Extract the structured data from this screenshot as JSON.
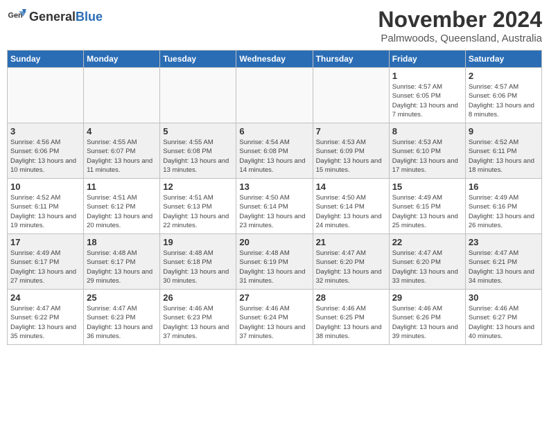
{
  "header": {
    "logo_general": "General",
    "logo_blue": "Blue",
    "month": "November 2024",
    "location": "Palmwoods, Queensland, Australia"
  },
  "weekdays": [
    "Sunday",
    "Monday",
    "Tuesday",
    "Wednesday",
    "Thursday",
    "Friday",
    "Saturday"
  ],
  "weeks": [
    [
      {
        "day": "",
        "info": ""
      },
      {
        "day": "",
        "info": ""
      },
      {
        "day": "",
        "info": ""
      },
      {
        "day": "",
        "info": ""
      },
      {
        "day": "",
        "info": ""
      },
      {
        "day": "1",
        "info": "Sunrise: 4:57 AM\nSunset: 6:05 PM\nDaylight: 13 hours and 7 minutes."
      },
      {
        "day": "2",
        "info": "Sunrise: 4:57 AM\nSunset: 6:06 PM\nDaylight: 13 hours and 8 minutes."
      }
    ],
    [
      {
        "day": "3",
        "info": "Sunrise: 4:56 AM\nSunset: 6:06 PM\nDaylight: 13 hours and 10 minutes."
      },
      {
        "day": "4",
        "info": "Sunrise: 4:55 AM\nSunset: 6:07 PM\nDaylight: 13 hours and 11 minutes."
      },
      {
        "day": "5",
        "info": "Sunrise: 4:55 AM\nSunset: 6:08 PM\nDaylight: 13 hours and 13 minutes."
      },
      {
        "day": "6",
        "info": "Sunrise: 4:54 AM\nSunset: 6:08 PM\nDaylight: 13 hours and 14 minutes."
      },
      {
        "day": "7",
        "info": "Sunrise: 4:53 AM\nSunset: 6:09 PM\nDaylight: 13 hours and 15 minutes."
      },
      {
        "day": "8",
        "info": "Sunrise: 4:53 AM\nSunset: 6:10 PM\nDaylight: 13 hours and 17 minutes."
      },
      {
        "day": "9",
        "info": "Sunrise: 4:52 AM\nSunset: 6:11 PM\nDaylight: 13 hours and 18 minutes."
      }
    ],
    [
      {
        "day": "10",
        "info": "Sunrise: 4:52 AM\nSunset: 6:11 PM\nDaylight: 13 hours and 19 minutes."
      },
      {
        "day": "11",
        "info": "Sunrise: 4:51 AM\nSunset: 6:12 PM\nDaylight: 13 hours and 20 minutes."
      },
      {
        "day": "12",
        "info": "Sunrise: 4:51 AM\nSunset: 6:13 PM\nDaylight: 13 hours and 22 minutes."
      },
      {
        "day": "13",
        "info": "Sunrise: 4:50 AM\nSunset: 6:14 PM\nDaylight: 13 hours and 23 minutes."
      },
      {
        "day": "14",
        "info": "Sunrise: 4:50 AM\nSunset: 6:14 PM\nDaylight: 13 hours and 24 minutes."
      },
      {
        "day": "15",
        "info": "Sunrise: 4:49 AM\nSunset: 6:15 PM\nDaylight: 13 hours and 25 minutes."
      },
      {
        "day": "16",
        "info": "Sunrise: 4:49 AM\nSunset: 6:16 PM\nDaylight: 13 hours and 26 minutes."
      }
    ],
    [
      {
        "day": "17",
        "info": "Sunrise: 4:49 AM\nSunset: 6:17 PM\nDaylight: 13 hours and 27 minutes."
      },
      {
        "day": "18",
        "info": "Sunrise: 4:48 AM\nSunset: 6:17 PM\nDaylight: 13 hours and 29 minutes."
      },
      {
        "day": "19",
        "info": "Sunrise: 4:48 AM\nSunset: 6:18 PM\nDaylight: 13 hours and 30 minutes."
      },
      {
        "day": "20",
        "info": "Sunrise: 4:48 AM\nSunset: 6:19 PM\nDaylight: 13 hours and 31 minutes."
      },
      {
        "day": "21",
        "info": "Sunrise: 4:47 AM\nSunset: 6:20 PM\nDaylight: 13 hours and 32 minutes."
      },
      {
        "day": "22",
        "info": "Sunrise: 4:47 AM\nSunset: 6:20 PM\nDaylight: 13 hours and 33 minutes."
      },
      {
        "day": "23",
        "info": "Sunrise: 4:47 AM\nSunset: 6:21 PM\nDaylight: 13 hours and 34 minutes."
      }
    ],
    [
      {
        "day": "24",
        "info": "Sunrise: 4:47 AM\nSunset: 6:22 PM\nDaylight: 13 hours and 35 minutes."
      },
      {
        "day": "25",
        "info": "Sunrise: 4:47 AM\nSunset: 6:23 PM\nDaylight: 13 hours and 36 minutes."
      },
      {
        "day": "26",
        "info": "Sunrise: 4:46 AM\nSunset: 6:23 PM\nDaylight: 13 hours and 37 minutes."
      },
      {
        "day": "27",
        "info": "Sunrise: 4:46 AM\nSunset: 6:24 PM\nDaylight: 13 hours and 37 minutes."
      },
      {
        "day": "28",
        "info": "Sunrise: 4:46 AM\nSunset: 6:25 PM\nDaylight: 13 hours and 38 minutes."
      },
      {
        "day": "29",
        "info": "Sunrise: 4:46 AM\nSunset: 6:26 PM\nDaylight: 13 hours and 39 minutes."
      },
      {
        "day": "30",
        "info": "Sunrise: 4:46 AM\nSunset: 6:27 PM\nDaylight: 13 hours and 40 minutes."
      }
    ]
  ]
}
